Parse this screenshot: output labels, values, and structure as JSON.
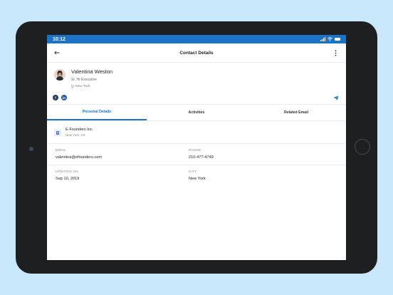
{
  "status": {
    "time": "10:12"
  },
  "appbar": {
    "title": "Contact Details"
  },
  "profile": {
    "name": "Valentina Weston",
    "role": "Sr. Hr Executive",
    "location": "New York"
  },
  "social": {
    "facebook": "f",
    "linkedin": "in"
  },
  "tabs": [
    {
      "label": "Personal Details",
      "active": true
    },
    {
      "label": "Activities",
      "active": false
    },
    {
      "label": "Related Email",
      "active": false
    }
  ],
  "company": {
    "name": "E-Founders Inc.",
    "location": "New York, US"
  },
  "details": {
    "email_label": "EMAIL",
    "email": "valentina@efounders.com",
    "phone_label": "PHONE",
    "phone": "210-477-4749",
    "updated_label": "UPDATED ON",
    "updated": "Sep 10, 2019",
    "city_label": "CITY",
    "city": "New York"
  },
  "colors": {
    "accent": "#1a73c8",
    "background": "#c9e8fb"
  }
}
